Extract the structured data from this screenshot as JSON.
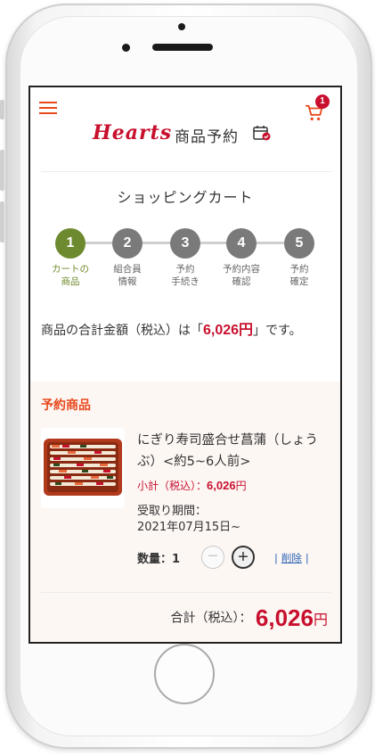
{
  "header": {
    "brand": "Hearts",
    "title": "商品予約",
    "cart_count": "1"
  },
  "page": {
    "heading": "ショッピングカート"
  },
  "steps": [
    {
      "num": "1",
      "label": "カートの\n商品",
      "active": true
    },
    {
      "num": "2",
      "label": "組合員\n情報",
      "active": false
    },
    {
      "num": "3",
      "label": "予約\n手続き",
      "active": false
    },
    {
      "num": "4",
      "label": "予約内容\n確認",
      "active": false
    },
    {
      "num": "5",
      "label": "予約\n確定",
      "active": false
    }
  ],
  "summary": {
    "prefix": "商品の合計金額（税込）は「",
    "amount": "6,026円",
    "suffix": "」です。"
  },
  "items_section": {
    "title": "予約商品",
    "item": {
      "name": "にぎり寿司盛合せ菖蒲（しょうぶ）<約5~6人前>",
      "subtotal_label": "小計（税込）：",
      "subtotal_value": "6,026",
      "subtotal_unit": "円",
      "pickup_label": "受取り期間：",
      "pickup_date": "2021年07月15日~",
      "qty_label": "数量：1",
      "qty_minus": "−",
      "qty_plus": "+",
      "delete_label": "削除"
    },
    "total_label": "合計（税込）：",
    "total_value": "6,026",
    "total_unit": "円"
  },
  "colors": {
    "accent": "#e8491d",
    "brand": "#c8102e",
    "step_active": "#6e8a2e",
    "step_inactive": "#7a7a7a"
  }
}
